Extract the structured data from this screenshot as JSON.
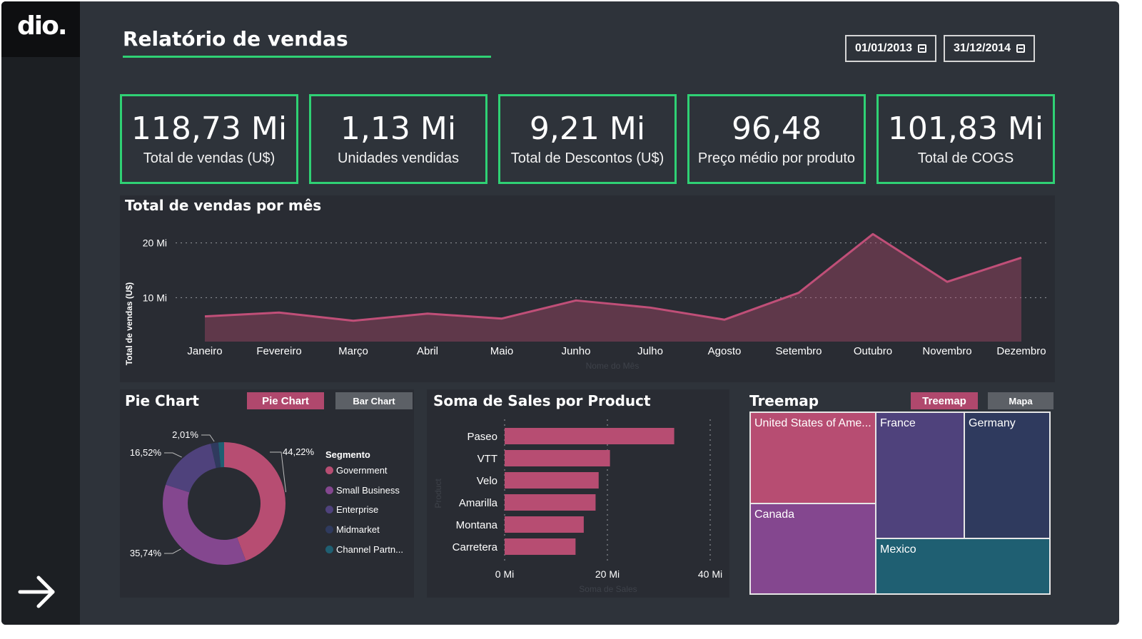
{
  "app": {
    "logo_text": "dio.",
    "title": "Relatório de vendas"
  },
  "filters": {
    "start_date": "01/01/2013",
    "end_date": "31/12/2014"
  },
  "kpis": [
    {
      "value": "118,73 Mi",
      "label": "Total de vendas (U$)"
    },
    {
      "value": "1,13 Mi",
      "label": "Unidades vendidas"
    },
    {
      "value": "9,21 Mi",
      "label": "Total de Descontos (U$)"
    },
    {
      "value": "96,48",
      "label": "Preço médio por produto"
    },
    {
      "value": "101,83 Mi",
      "label": "Total de COGS"
    }
  ],
  "colors": {
    "accent_green": "#2fd174",
    "brand_pink": "#b0486d",
    "purple": "#84478f",
    "indigo": "#4f427c",
    "navy": "#2f3a5e",
    "teal": "#1f5f72"
  },
  "chart_data": [
    {
      "type": "area",
      "title": "Total de vendas por mês",
      "xlabel": "Nome do Mês",
      "ylabel": "Total de vendas (U$)",
      "ytick_labels": [
        "20 Mi",
        "10 Mi"
      ],
      "yticks": [
        20,
        10
      ],
      "ylim": [
        2,
        21.5
      ],
      "grid": true,
      "categories": [
        "Janeiro",
        "Fevereiro",
        "Março",
        "Abril",
        "Maio",
        "Junho",
        "Julho",
        "Agosto",
        "Setembro",
        "Outubro",
        "Novembro",
        "Dezembro"
      ],
      "values": [
        6.6,
        7.3,
        5.8,
        7.1,
        6.2,
        9.5,
        8.2,
        6.0,
        10.9,
        21.6,
        12.9,
        17.3
      ]
    },
    {
      "type": "pie",
      "title": "Pie Chart",
      "legend_title": "Segmento",
      "legend_position": "right",
      "slices": [
        {
          "name": "Government",
          "value": 44.22,
          "label": "44,22%",
          "color": "#b74d72"
        },
        {
          "name": "Small Business",
          "value": 35.74,
          "label": "35,74%",
          "color": "#84478f"
        },
        {
          "name": "Enterprise",
          "value": 16.52,
          "label": "16,52%",
          "color": "#4f427c"
        },
        {
          "name": "Midmarket",
          "value": 2.01,
          "label": "2,01%",
          "color": "#2f3a5e"
        },
        {
          "name": "Channel Partn...",
          "value": 1.51,
          "label": "",
          "color": "#1f5f72"
        }
      ]
    },
    {
      "type": "bar",
      "orientation": "horizontal",
      "title": "Soma de Sales por Product",
      "xlabel": "Soma de Sales",
      "ylabel": "Product",
      "xtick_labels": [
        "0 Mi",
        "20 Mi",
        "40 Mi"
      ],
      "xticks": [
        0,
        20,
        40
      ],
      "xlim": [
        0,
        40
      ],
      "grid": true,
      "categories": [
        "Paseo",
        "VTT",
        "Velo",
        "Amarilla",
        "Montana",
        "Carretera"
      ],
      "values": [
        33.0,
        20.5,
        18.3,
        17.7,
        15.4,
        13.8
      ]
    },
    {
      "type": "treemap",
      "title": "Treemap",
      "items": [
        {
          "name": "United States of Ame...",
          "color": "#b74d72"
        },
        {
          "name": "Canada",
          "color": "#84478f"
        },
        {
          "name": "France",
          "color": "#4f427c"
        },
        {
          "name": "Germany",
          "color": "#2f3a5e"
        },
        {
          "name": "Mexico",
          "color": "#1f5f72"
        }
      ]
    }
  ],
  "toggles": {
    "pie_active": "Pie Chart",
    "bar_inactive": "Bar Chart",
    "treemap_active": "Treemap",
    "map_inactive": "Mapa"
  }
}
